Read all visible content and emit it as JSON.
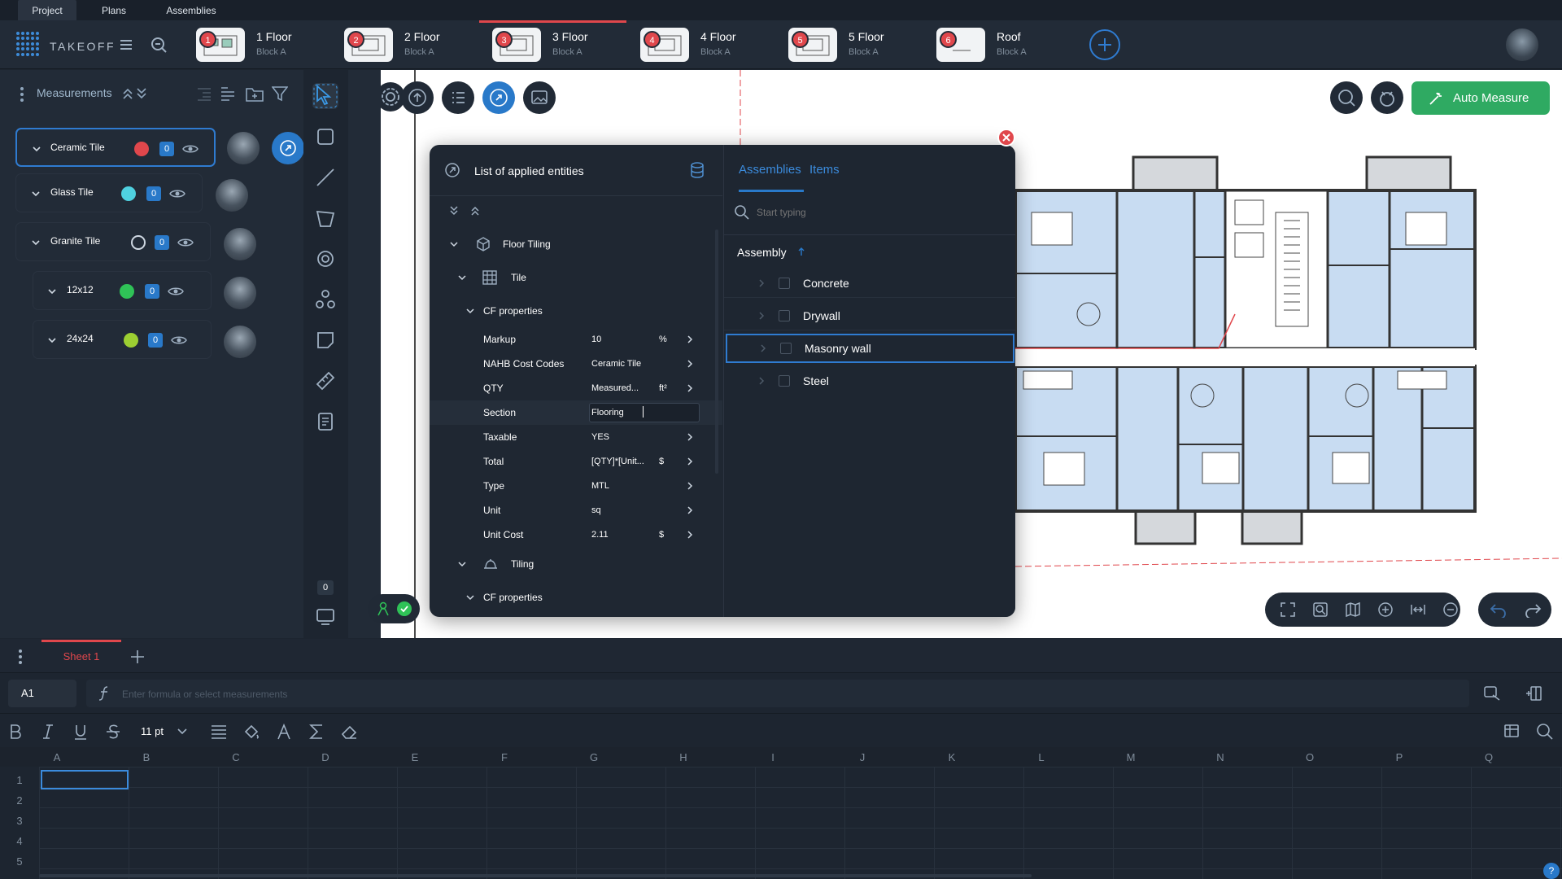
{
  "topnav": {
    "items": [
      "Project",
      "Plans",
      "Assemblies"
    ]
  },
  "header": {
    "brand": "TAKEOFF",
    "plan_tabs": [
      {
        "badge": "1",
        "title": "1 Floor",
        "subtitle": "Block A"
      },
      {
        "badge": "2",
        "title": "2 Floor",
        "subtitle": "Block A"
      },
      {
        "badge": "3",
        "title": "3 Floor",
        "subtitle": "Block A"
      },
      {
        "badge": "4",
        "title": "4 Floor",
        "subtitle": "Block A"
      },
      {
        "badge": "5",
        "title": "5 Floor",
        "subtitle": "Block A"
      },
      {
        "badge": "6",
        "title": "Roof",
        "subtitle": "Block A"
      }
    ],
    "active_tab": "3 Floor"
  },
  "measurements": {
    "title": "Measurements",
    "items": [
      {
        "name": "Ceramic Tile",
        "color": "#e0474c",
        "count": "0"
      },
      {
        "name": "Glass Tile",
        "color": "#4fd1e0",
        "count": "0"
      },
      {
        "name": "Granite Tile",
        "color": "transparent",
        "count": "0"
      },
      {
        "name": "12x12",
        "color": "#2fc257",
        "count": "0"
      },
      {
        "name": "24x24",
        "color": "#9ccf32",
        "count": "0"
      }
    ]
  },
  "toolrail": {
    "counter": "0"
  },
  "canvas": {
    "auto_measure_label": "Auto Measure"
  },
  "entities_panel": {
    "title": "List of applied entities",
    "group": "Floor Tiling",
    "subgroup": "Tile",
    "cf_label": "CF properties",
    "properties": [
      {
        "name": "Markup",
        "value": "10",
        "unit": "%"
      },
      {
        "name": "NAHB Cost Codes",
        "value": "Ceramic Tile",
        "unit": ""
      },
      {
        "name": "QTY",
        "value": "Measured...",
        "unit": "ft²"
      },
      {
        "name": "Section",
        "value": "Flooring",
        "unit": ""
      },
      {
        "name": "Taxable",
        "value": "YES",
        "unit": ""
      },
      {
        "name": "Total",
        "value": "[QTY]*[Unit...",
        "unit": "$"
      },
      {
        "name": "Type",
        "value": "MTL",
        "unit": ""
      },
      {
        "name": "Unit",
        "value": "sq",
        "unit": ""
      },
      {
        "name": "Unit Cost",
        "value": "2.11",
        "unit": "$"
      }
    ],
    "subgroup2": "Tiling",
    "cf_label2": "CF properties",
    "tabs": [
      "Assemblies",
      "Items"
    ],
    "search_placeholder": "Start typing",
    "assembly_header": "Assembly",
    "assemblies": [
      "Concrete",
      "Drywall",
      "Masonry wall",
      "Steel"
    ],
    "selected_assembly": "Masonry wall"
  },
  "spreadsheet": {
    "sheet_tab": "Sheet 1",
    "cell_ref": "A1",
    "formula_placeholder": "Enter formula or select measurements",
    "font_size": "11 pt",
    "columns": [
      "A",
      "B",
      "C",
      "D",
      "E",
      "F",
      "G",
      "H",
      "I",
      "J",
      "K",
      "L",
      "M",
      "N",
      "O",
      "P",
      "Q"
    ],
    "rows": [
      "1",
      "2",
      "3",
      "4",
      "5"
    ]
  },
  "colors": {
    "accent": "#2979c9",
    "danger": "#e0474c",
    "success": "#2faa62"
  }
}
